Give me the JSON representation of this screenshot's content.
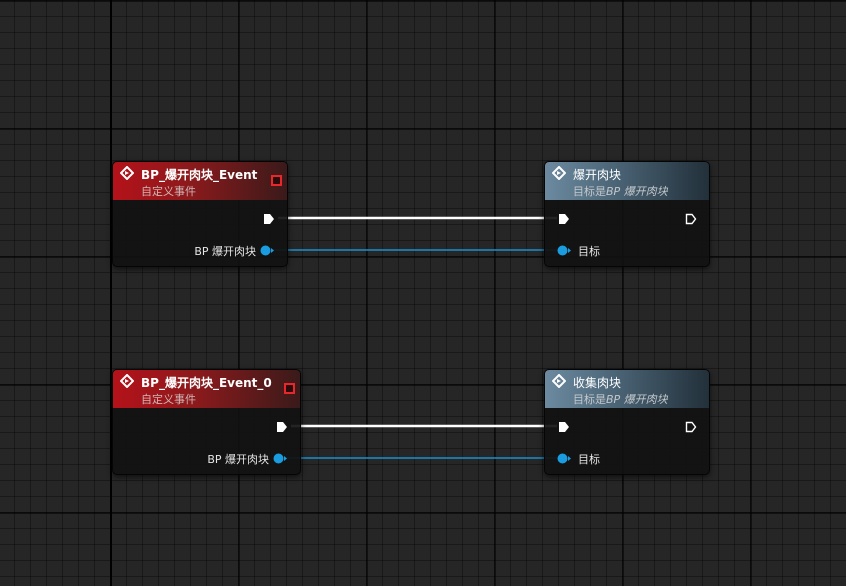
{
  "nodes": [
    {
      "title": "BP_爆开肉块_Event",
      "subtitle": "自定义事件",
      "output_label": "BP 爆开肉块"
    },
    {
      "title": "爆开肉块",
      "subtitle_prefix": "目标是",
      "subtitle_em": "BP 爆开肉块",
      "input_label": "目标"
    },
    {
      "title": "BP_爆开肉块_Event_0",
      "subtitle": "自定义事件",
      "output_label": "BP 爆开肉块"
    },
    {
      "title": "收集肉块",
      "subtitle_prefix": "目标是",
      "subtitle_em": "BP 爆开肉块",
      "input_label": "目标"
    }
  ],
  "colors": {
    "event_header": "#b4121a",
    "function_header": "#4d6779",
    "exec_wire": "#ffffff",
    "object_pin": "#1a9de0",
    "delegate_pin": "#e8272d",
    "grid": "#262626"
  },
  "icons": [
    "event-icon",
    "function-icon",
    "exec-pin-icon",
    "object-pin-icon",
    "delegate-pin-icon"
  ]
}
